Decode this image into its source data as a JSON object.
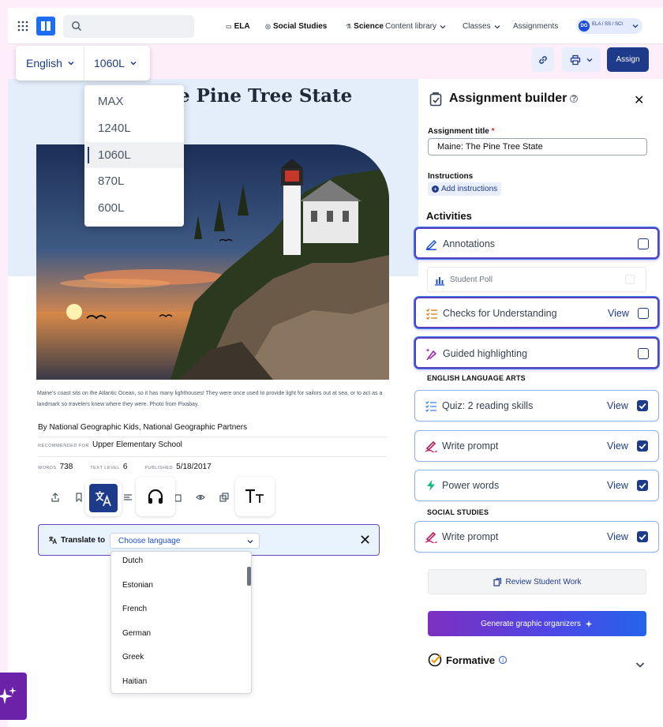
{
  "nav": {
    "ela": "ELA",
    "social_studies": "Social Studies",
    "science": "Science",
    "content_library": "Content library",
    "classes": "Classes",
    "assignments": "Assignments",
    "user_initials": "DG",
    "user_subjects": "ELA / SS / SCI"
  },
  "reader": {
    "language": "English",
    "lexile": "1060L",
    "lexile_options": [
      "MAX",
      "1240L",
      "1060L",
      "870L",
      "600L"
    ],
    "lexile_selected": "1060L"
  },
  "article": {
    "title_visible": "e Pine Tree State",
    "caption": "Maine's coast sits on the Atlantic Ocean, so it has many lighthouses! They were once used to provide light for sailors out at sea, or to act as a landmark so travelers knew where they were. Photo from Pixabay.",
    "byline": "By National Geographic Kids, National Geographic Partners",
    "recommended_label": "RECOMMENDED FOR",
    "recommended_value": "Upper Elementary School",
    "words_label": "WORDS",
    "words_value": "738",
    "text_level_label": "TEXT LEVEL",
    "text_level_value": "6",
    "published_label": "PUBLISHED",
    "published_value": "5/18/2017"
  },
  "translate": {
    "label": "Translate to",
    "placeholder": "Choose language",
    "languages": [
      "Dutch",
      "Estonian",
      "French",
      "German",
      "Greek",
      "Haitian"
    ]
  },
  "header_actions": {
    "assign": "Assign"
  },
  "builder": {
    "title": "Assignment builder",
    "assignment_title_label": "Assignment title",
    "required_mark": "*",
    "assignment_title_value": "Maine: The Pine Tree State",
    "instructions_label": "Instructions",
    "add_instructions": "Add instructions",
    "activities_heading": "Activities",
    "view": "View",
    "annotations": "Annotations",
    "student_poll": "Student Poll",
    "checks": "Checks for Understanding",
    "guided": "Guided highlighting",
    "ela_heading": "ENGLISH LANGUAGE ARTS",
    "quiz": "Quiz: 2 reading skills",
    "write_prompt": "Write prompt",
    "power_words": "Power words",
    "ss_heading": "SOCIAL STUDIES",
    "write_prompt_ss": "Write prompt",
    "review": "Review Student Work",
    "generate": "Generate graphic organizers",
    "formative": "Formative"
  },
  "colors": {
    "accent": "#1e3a8a",
    "highlight_border": "#5b3fb8",
    "page_bg": "#fdeefa"
  }
}
